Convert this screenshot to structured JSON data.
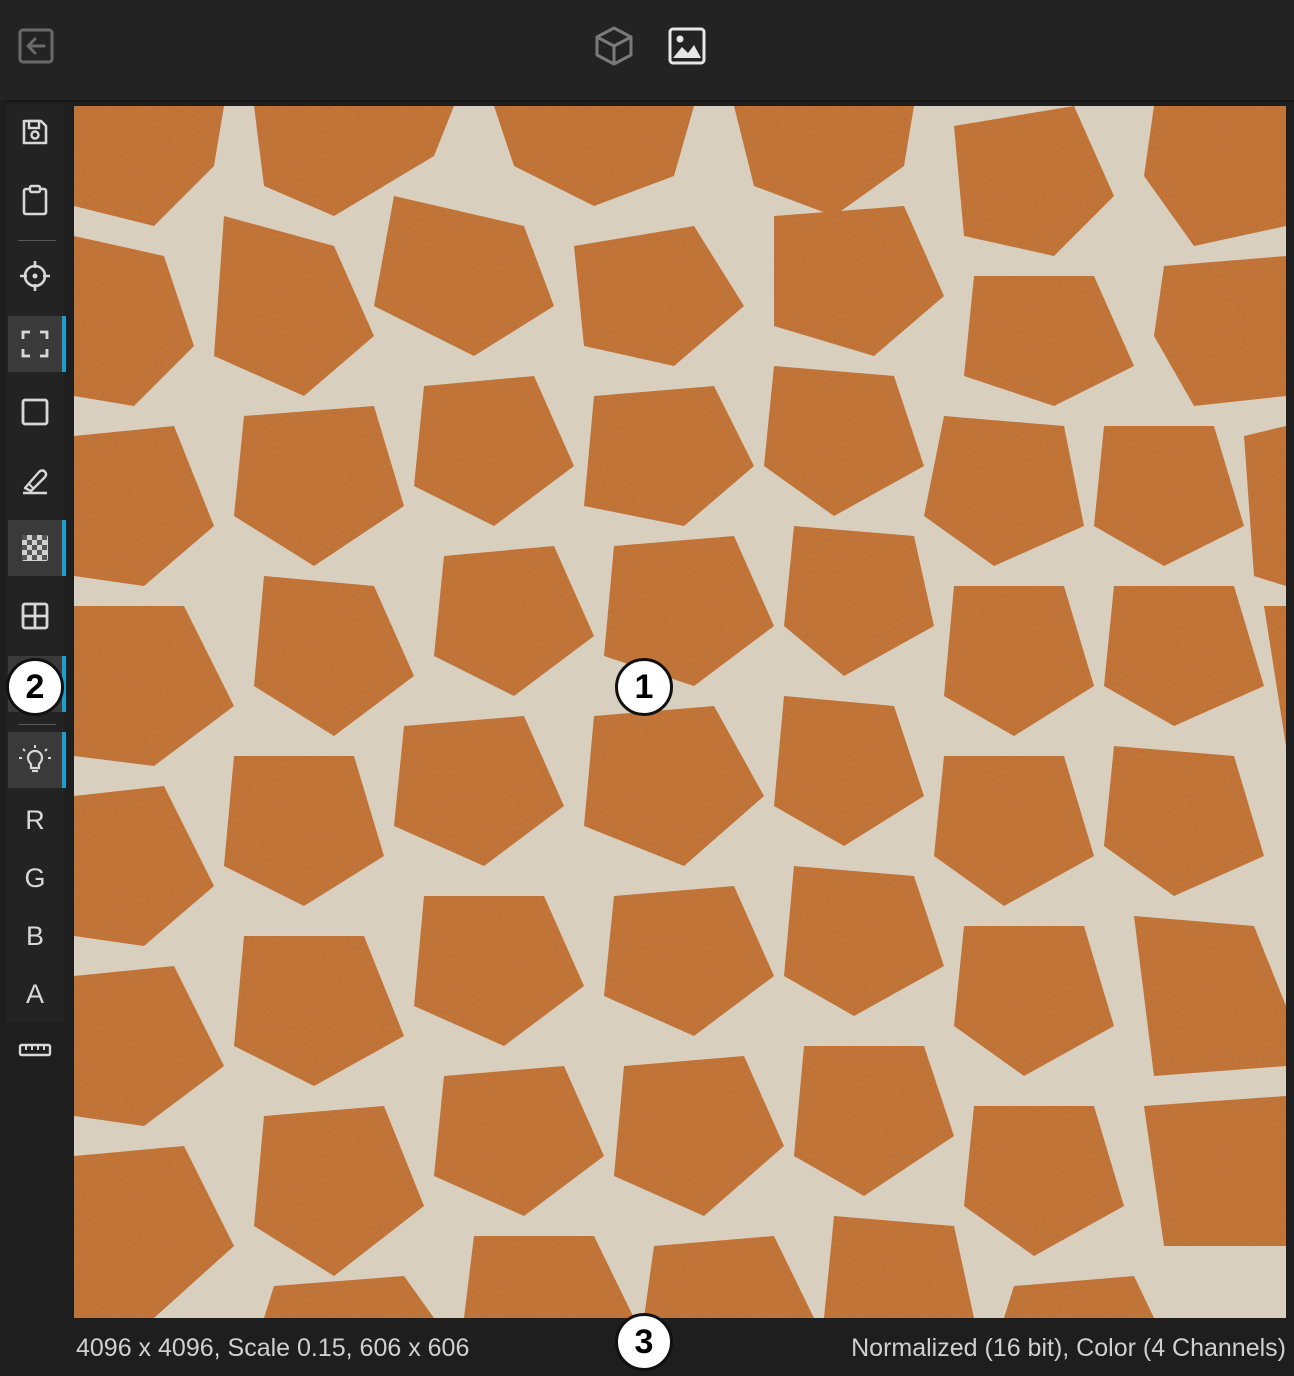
{
  "topbar": {
    "back_icon": "back-arrow-icon",
    "view_3d_icon": "cube-icon",
    "view_2d_icon": "image-icon"
  },
  "toolbar": {
    "tools": [
      {
        "name": "save",
        "icon": "floppy-disk-icon"
      },
      {
        "name": "clipboard",
        "icon": "clipboard-icon"
      },
      {
        "name": "center",
        "icon": "crosshair-icon"
      },
      {
        "name": "fit",
        "icon": "fit-frame-icon"
      },
      {
        "name": "border",
        "icon": "square-icon"
      },
      {
        "name": "draw",
        "icon": "pen-icon"
      },
      {
        "name": "checker",
        "icon": "checkerboard-icon"
      },
      {
        "name": "grid",
        "icon": "grid-icon"
      },
      {
        "name": "light",
        "icon": "lightbulb-icon"
      },
      {
        "name": "ruler",
        "icon": "ruler-icon"
      }
    ],
    "channel_r": "R",
    "channel_g": "G",
    "channel_b": "B",
    "channel_a": "A"
  },
  "status": {
    "left": "4096 x 4096, Scale 0.15, 606 x 606",
    "right": "Normalized (16 bit), Color (4 Channels)"
  },
  "callouts": {
    "one": "1",
    "two": "2",
    "three": "3"
  },
  "colors": {
    "accent": "#1b9fcf",
    "fur_orange": "#c9793a",
    "fur_cream": "#d9cfbf"
  }
}
